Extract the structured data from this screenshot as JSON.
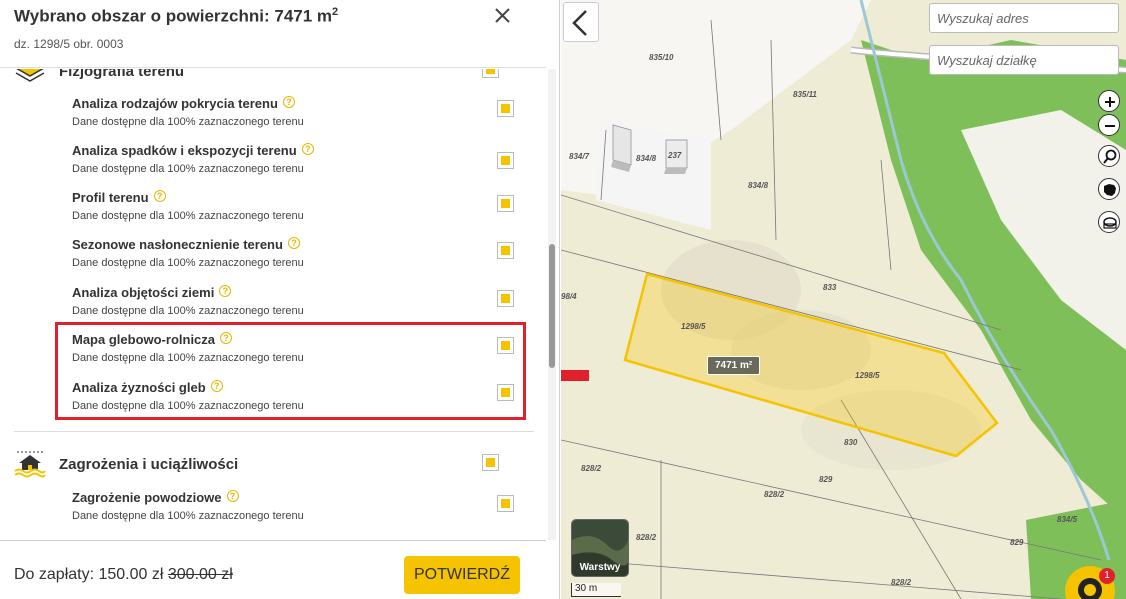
{
  "panel": {
    "title": "Wybrano obszar o powierzchni: 7471 m",
    "title_sup": "2",
    "subtitle": "dz. 1298/5 obr. 0003"
  },
  "sections": [
    {
      "title": "Fizjografia terenu",
      "items": [
        {
          "title": "Analiza rodzajów pokrycia terenu",
          "sub": "Dane dostępne dla 100% zaznaczonego terenu"
        },
        {
          "title": "Analiza spadków i ekspozycji terenu",
          "sub": "Dane dostępne dla 100% zaznaczonego terenu"
        },
        {
          "title": "Profil terenu",
          "sub": "Dane dostępne dla 100% zaznaczonego terenu"
        },
        {
          "title": "Sezonowe nasłonecznienie terenu",
          "sub": "Dane dostępne dla 100% zaznaczonego terenu"
        },
        {
          "title": "Analiza objętości ziemi",
          "sub": "Dane dostępne dla 100% zaznaczonego terenu"
        },
        {
          "title": "Mapa glebowo-rolnicza",
          "sub": "Dane dostępne dla 100% zaznaczonego terenu"
        },
        {
          "title": "Analiza żyzności gleb",
          "sub": "Dane dostępne dla 100% zaznaczonego terenu"
        }
      ]
    },
    {
      "title": "Zagrożenia i uciążliwości",
      "items": [
        {
          "title": "Zagrożenie powodziowe",
          "sub": "Dane dostępne dla 100% zaznaczonego terenu"
        }
      ]
    }
  ],
  "help_glyph": "?",
  "footer": {
    "price_label": "Do zapłaty: 150.00 zł",
    "price_old": "300.00 zł",
    "confirm_label": "POTWIERDŹ"
  },
  "map": {
    "search_address_placeholder": "Wyszukaj adres",
    "search_plot_placeholder": "Wyszukaj działkę",
    "zoom_in": "+",
    "zoom_out": "−",
    "layers_label": "Warstwy",
    "scale_label": "30 m",
    "chat_badge": "1",
    "area_badge": "7471 m²",
    "plot_labels": [
      "835/10",
      "835/11",
      "834/7",
      "834/8",
      "237",
      "834/8",
      "833",
      "98/4",
      "1298/5",
      "1298/5",
      "830",
      "829",
      "828/2",
      "828/2",
      "828/2",
      "828/2",
      "834/5",
      "829"
    ],
    "colors": {
      "accent": "#f5c300",
      "highlight": "#e0202a",
      "forest": "#7fbf5a",
      "field": "#efecd6",
      "selection": "#f5c300"
    }
  },
  "icons": {
    "close": "close-icon",
    "back": "chevron-left-icon",
    "zoom_in": "plus-icon",
    "zoom_out": "minus-icon",
    "search": "magnifier-icon",
    "region": "poland-map-icon",
    "measure": "measure-icon",
    "chat": "chat-icon",
    "arrow": "red-arrow-icon"
  }
}
